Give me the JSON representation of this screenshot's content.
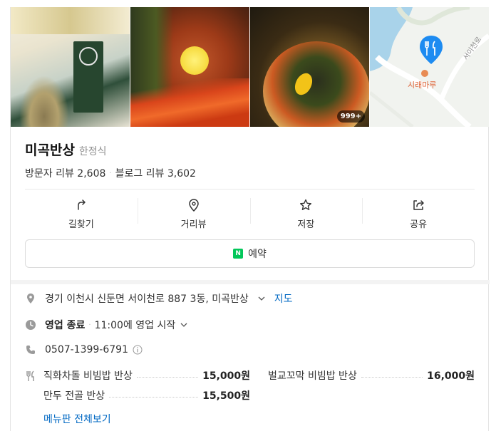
{
  "photos": {
    "count_badge": "999+",
    "map": {
      "place_label": "시래마루",
      "road_label": "서이천로"
    }
  },
  "place": {
    "name": "미곡반상",
    "category": "한정식",
    "visitor_reviews": "방문자 리뷰 2,608",
    "blog_reviews": "블로그 리뷰 3,602"
  },
  "actions": [
    {
      "label": "길찾기",
      "icon": "directions-icon"
    },
    {
      "label": "거리뷰",
      "icon": "streetview-pin-icon"
    },
    {
      "label": "저장",
      "icon": "star-icon"
    },
    {
      "label": "공유",
      "icon": "share-icon"
    }
  ],
  "reserve": {
    "label": "예약",
    "logo": "N"
  },
  "info": {
    "address": "경기 이천시 신둔면 서이천로 887 3동, 미곡반상",
    "map_link": "지도",
    "status": "영업 종료",
    "next_open": "11:00에 영업 시작",
    "phone": "0507-1399-6791"
  },
  "menu": {
    "items": [
      {
        "name": "직화차돌 비빔밥 반상",
        "price": "15,000원"
      },
      {
        "name": "벌교꼬막 비빔밥 반상",
        "price": "16,000원"
      },
      {
        "name": "만두 전골 반상",
        "price": "15,500원"
      }
    ],
    "more_link": "메뉴판 전체보기"
  },
  "colors": {
    "link": "#0068c3",
    "naver_green": "#03c75a",
    "map_pin": "#1d8bf1",
    "map_place": "#e0673c"
  }
}
